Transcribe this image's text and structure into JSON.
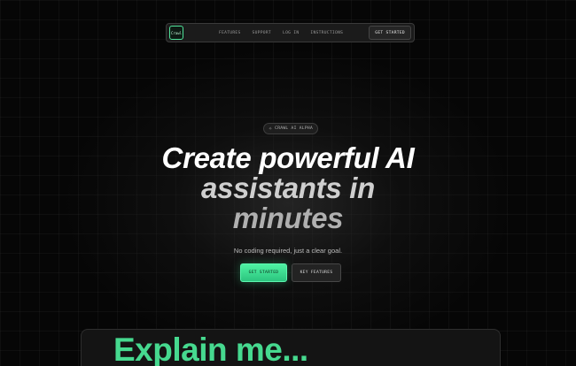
{
  "nav": {
    "logo_text": "Crawl",
    "links": [
      "FEATURES",
      "SUPPORT",
      "LOG IN",
      "INSTRUCTIONS"
    ],
    "cta_label": "GET STARTED"
  },
  "hero": {
    "badge_icon": "sparkle-icon",
    "badge_text": "CRAWL AI ALPHA",
    "headline_line1": "Create powerful AI",
    "headline_line2": "assistants in",
    "headline_line3": "minutes",
    "subtitle": "No coding required, just a clear goal.",
    "primary_cta": "GET STARTED",
    "secondary_cta": "KEY FEATURES"
  },
  "demo": {
    "text": "Explain me..."
  },
  "colors": {
    "accent": "#46d98f",
    "background": "#060606"
  }
}
